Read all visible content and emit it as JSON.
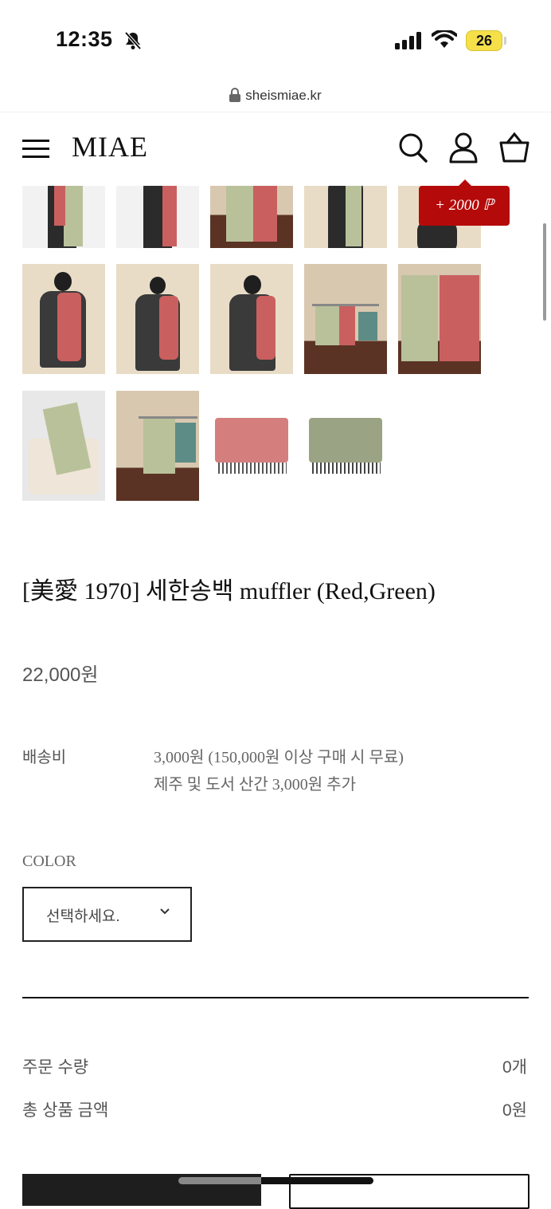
{
  "status_bar": {
    "time": "12:35",
    "battery": "26",
    "icons": [
      "bell-slash-icon",
      "signal-icon",
      "wifi-icon",
      "battery-icon"
    ]
  },
  "browser": {
    "url": "sheismiae.kr",
    "icon": "lock-icon"
  },
  "header": {
    "logo": "MIAE",
    "icons": [
      "menu-icon",
      "search-icon",
      "user-icon",
      "cart-icon"
    ],
    "points_badge": "+ 2000 ℙ"
  },
  "gallery": {
    "thumbnails": [
      "model-scarf",
      "model-scarf",
      "scarf-on-rack",
      "model-scarf",
      "model-scarf",
      "model-scarf",
      "model-scarf",
      "model-scarf",
      "scarf-on-rack",
      "scarf-on-rack",
      "scarf-on-chair",
      "scarf-on-rack",
      "scarf-folded-red",
      "scarf-folded-green"
    ]
  },
  "product": {
    "title": "[美愛 1970] 세한송백 muffler (Red,Green)",
    "price": "22,000원",
    "shipping_label": "배송비",
    "shipping_line1": "3,000원 (150,000원 이상 구매 시 무료)",
    "shipping_line2": "제주 및 도서 산간 3,000원 추가",
    "color_label": "COLOR",
    "color_select": "선택하세요."
  },
  "summary": {
    "qty_label": "주문 수량",
    "qty_value": "0개",
    "total_label": "총 상품 금액",
    "total_value": "0원"
  },
  "colors": {
    "accent_red": "#b50a0a",
    "scarf_red": "#c9605f",
    "scarf_green": "#b9c19a"
  }
}
